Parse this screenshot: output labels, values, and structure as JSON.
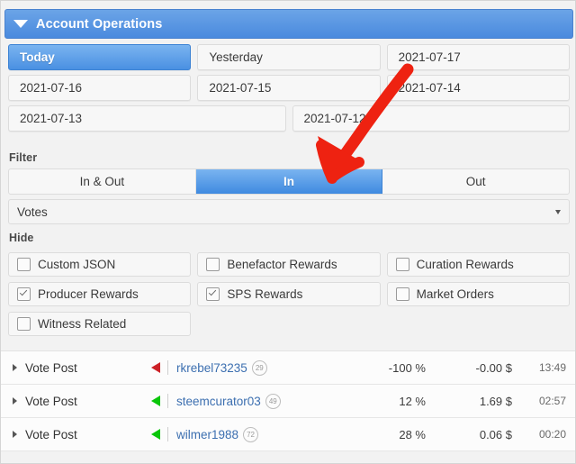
{
  "header": {
    "title": "Account Operations",
    "collapse_icon": "caret-down-icon"
  },
  "date_buttons": [
    [
      {
        "label": "Today",
        "active": true
      },
      {
        "label": "Yesterday",
        "active": false
      },
      {
        "label": "2021-07-17",
        "active": false
      }
    ],
    [
      {
        "label": "2021-07-16",
        "active": false
      },
      {
        "label": "2021-07-15",
        "active": false
      },
      {
        "label": "2021-07-14",
        "active": false
      }
    ],
    [
      {
        "label": "2021-07-13",
        "active": false
      },
      {
        "label": "2021-07-12",
        "active": false
      }
    ]
  ],
  "filter": {
    "label": "Filter",
    "segments": [
      {
        "label": "In & Out",
        "active": false
      },
      {
        "label": "In",
        "active": true
      },
      {
        "label": "Out",
        "active": false
      }
    ],
    "select": {
      "value": "Votes",
      "caret_icon": "chevron-down-icon"
    }
  },
  "hide": {
    "label": "Hide",
    "rows": [
      [
        {
          "label": "Custom JSON",
          "checked": false
        },
        {
          "label": "Benefactor Rewards",
          "checked": false
        },
        {
          "label": "Curation Rewards",
          "checked": false
        }
      ],
      [
        {
          "label": "Producer Rewards",
          "checked": true
        },
        {
          "label": "SPS Rewards",
          "checked": true
        },
        {
          "label": "Market Orders",
          "checked": false
        }
      ],
      [
        {
          "label": "Witness Related",
          "checked": false
        }
      ]
    ]
  },
  "operations": [
    {
      "type": "Vote Post",
      "direction": "out",
      "user": "rkrebel73235",
      "reputation": "29",
      "percent": "-100 %",
      "amount": "-0.00 $",
      "time": "13:49"
    },
    {
      "type": "Vote Post",
      "direction": "in",
      "user": "steemcurator03",
      "reputation": "49",
      "percent": "12 %",
      "amount": "1.69 $",
      "time": "02:57"
    },
    {
      "type": "Vote Post",
      "direction": "in",
      "user": "wilmer1988",
      "reputation": "72",
      "percent": "28 %",
      "amount": "0.06 $",
      "time": "00:20"
    }
  ],
  "annotation": {
    "name": "red-arrow-annotation",
    "color": "#ee2211",
    "points_at": "In"
  },
  "colors": {
    "accent_blue": "#4a90e2",
    "panel_header": "#5d9ae4",
    "link_blue": "#3c6fb0",
    "positive_green": "#0ac60a",
    "negative_red": "#cc2127",
    "background": "#f2f2f2"
  }
}
